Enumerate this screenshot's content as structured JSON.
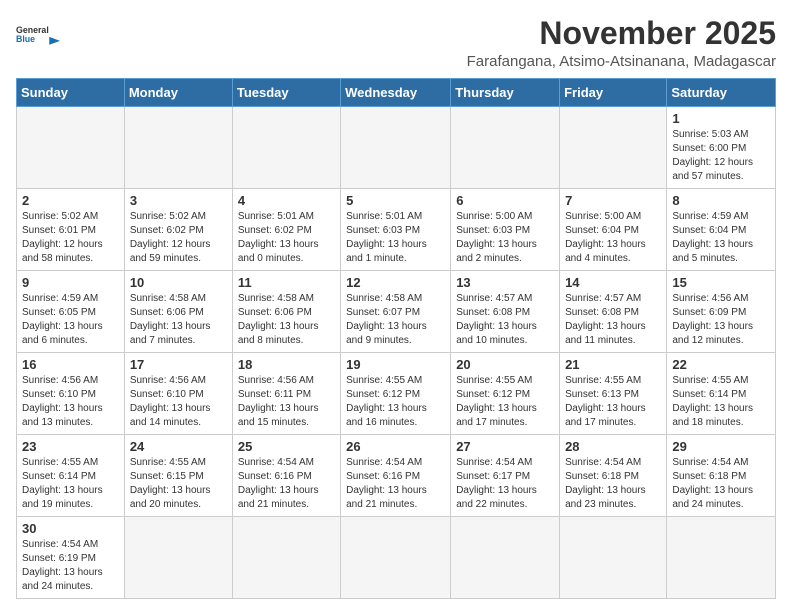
{
  "logo": {
    "general": "General",
    "blue": "Blue"
  },
  "title": {
    "month": "November 2025",
    "location": "Farafangana, Atsimo-Atsinanana, Madagascar"
  },
  "days_of_week": [
    "Sunday",
    "Monday",
    "Tuesday",
    "Wednesday",
    "Thursday",
    "Friday",
    "Saturday"
  ],
  "weeks": [
    [
      {
        "day": "",
        "info": ""
      },
      {
        "day": "",
        "info": ""
      },
      {
        "day": "",
        "info": ""
      },
      {
        "day": "",
        "info": ""
      },
      {
        "day": "",
        "info": ""
      },
      {
        "day": "",
        "info": ""
      },
      {
        "day": "1",
        "info": "Sunrise: 5:03 AM\nSunset: 6:00 PM\nDaylight: 12 hours and 57 minutes."
      }
    ],
    [
      {
        "day": "2",
        "info": "Sunrise: 5:02 AM\nSunset: 6:01 PM\nDaylight: 12 hours and 58 minutes."
      },
      {
        "day": "3",
        "info": "Sunrise: 5:02 AM\nSunset: 6:02 PM\nDaylight: 12 hours and 59 minutes."
      },
      {
        "day": "4",
        "info": "Sunrise: 5:01 AM\nSunset: 6:02 PM\nDaylight: 13 hours and 0 minutes."
      },
      {
        "day": "5",
        "info": "Sunrise: 5:01 AM\nSunset: 6:03 PM\nDaylight: 13 hours and 1 minute."
      },
      {
        "day": "6",
        "info": "Sunrise: 5:00 AM\nSunset: 6:03 PM\nDaylight: 13 hours and 2 minutes."
      },
      {
        "day": "7",
        "info": "Sunrise: 5:00 AM\nSunset: 6:04 PM\nDaylight: 13 hours and 4 minutes."
      },
      {
        "day": "8",
        "info": "Sunrise: 4:59 AM\nSunset: 6:04 PM\nDaylight: 13 hours and 5 minutes."
      }
    ],
    [
      {
        "day": "9",
        "info": "Sunrise: 4:59 AM\nSunset: 6:05 PM\nDaylight: 13 hours and 6 minutes."
      },
      {
        "day": "10",
        "info": "Sunrise: 4:58 AM\nSunset: 6:06 PM\nDaylight: 13 hours and 7 minutes."
      },
      {
        "day": "11",
        "info": "Sunrise: 4:58 AM\nSunset: 6:06 PM\nDaylight: 13 hours and 8 minutes."
      },
      {
        "day": "12",
        "info": "Sunrise: 4:58 AM\nSunset: 6:07 PM\nDaylight: 13 hours and 9 minutes."
      },
      {
        "day": "13",
        "info": "Sunrise: 4:57 AM\nSunset: 6:08 PM\nDaylight: 13 hours and 10 minutes."
      },
      {
        "day": "14",
        "info": "Sunrise: 4:57 AM\nSunset: 6:08 PM\nDaylight: 13 hours and 11 minutes."
      },
      {
        "day": "15",
        "info": "Sunrise: 4:56 AM\nSunset: 6:09 PM\nDaylight: 13 hours and 12 minutes."
      }
    ],
    [
      {
        "day": "16",
        "info": "Sunrise: 4:56 AM\nSunset: 6:10 PM\nDaylight: 13 hours and 13 minutes."
      },
      {
        "day": "17",
        "info": "Sunrise: 4:56 AM\nSunset: 6:10 PM\nDaylight: 13 hours and 14 minutes."
      },
      {
        "day": "18",
        "info": "Sunrise: 4:56 AM\nSunset: 6:11 PM\nDaylight: 13 hours and 15 minutes."
      },
      {
        "day": "19",
        "info": "Sunrise: 4:55 AM\nSunset: 6:12 PM\nDaylight: 13 hours and 16 minutes."
      },
      {
        "day": "20",
        "info": "Sunrise: 4:55 AM\nSunset: 6:12 PM\nDaylight: 13 hours and 17 minutes."
      },
      {
        "day": "21",
        "info": "Sunrise: 4:55 AM\nSunset: 6:13 PM\nDaylight: 13 hours and 17 minutes."
      },
      {
        "day": "22",
        "info": "Sunrise: 4:55 AM\nSunset: 6:14 PM\nDaylight: 13 hours and 18 minutes."
      }
    ],
    [
      {
        "day": "23",
        "info": "Sunrise: 4:55 AM\nSunset: 6:14 PM\nDaylight: 13 hours and 19 minutes."
      },
      {
        "day": "24",
        "info": "Sunrise: 4:55 AM\nSunset: 6:15 PM\nDaylight: 13 hours and 20 minutes."
      },
      {
        "day": "25",
        "info": "Sunrise: 4:54 AM\nSunset: 6:16 PM\nDaylight: 13 hours and 21 minutes."
      },
      {
        "day": "26",
        "info": "Sunrise: 4:54 AM\nSunset: 6:16 PM\nDaylight: 13 hours and 21 minutes."
      },
      {
        "day": "27",
        "info": "Sunrise: 4:54 AM\nSunset: 6:17 PM\nDaylight: 13 hours and 22 minutes."
      },
      {
        "day": "28",
        "info": "Sunrise: 4:54 AM\nSunset: 6:18 PM\nDaylight: 13 hours and 23 minutes."
      },
      {
        "day": "29",
        "info": "Sunrise: 4:54 AM\nSunset: 6:18 PM\nDaylight: 13 hours and 24 minutes."
      }
    ],
    [
      {
        "day": "30",
        "info": "Sunrise: 4:54 AM\nSunset: 6:19 PM\nDaylight: 13 hours and 24 minutes."
      },
      {
        "day": "",
        "info": ""
      },
      {
        "day": "",
        "info": ""
      },
      {
        "day": "",
        "info": ""
      },
      {
        "day": "",
        "info": ""
      },
      {
        "day": "",
        "info": ""
      },
      {
        "day": "",
        "info": ""
      }
    ]
  ]
}
